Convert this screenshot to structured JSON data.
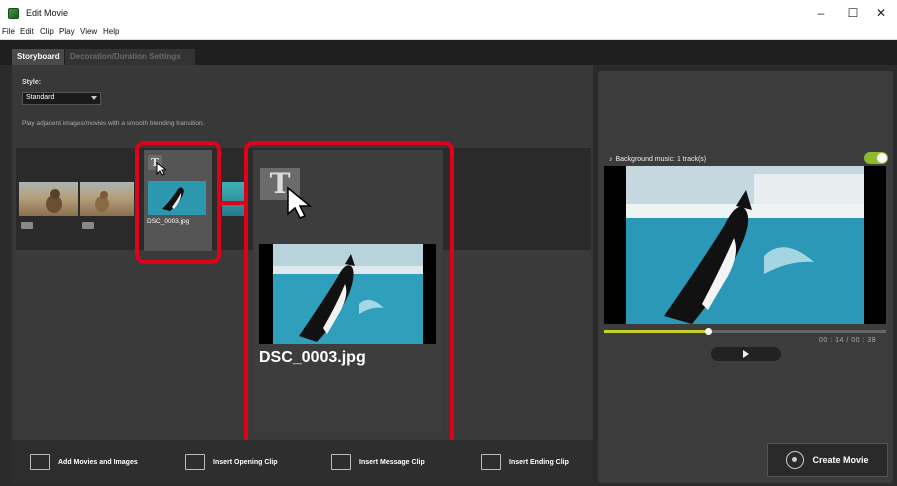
{
  "window": {
    "title": "Edit Movie",
    "minimize": "–",
    "maximize": "☐",
    "close": "✕"
  },
  "menu": [
    "File",
    "Edit",
    "Clip",
    "Play",
    "View",
    "Help"
  ],
  "tabs": [
    {
      "label": "Storyboard",
      "active": true
    },
    {
      "label": "Decoration/Duration Settings",
      "active": false
    }
  ],
  "style": {
    "label": "Style:",
    "value": "Standard",
    "description": "Play adjacent images/movies with a smooth blending transition."
  },
  "clips": {
    "selected_title_icon": "T",
    "selected_name": "DSC_0003.jpg",
    "zoom_name": "DSC_0003.jpg"
  },
  "bottom_buttons": [
    {
      "label": "Add Movies and Images",
      "icon": "add-media-icon"
    },
    {
      "label": "Insert Opening Clip",
      "icon": "opening-clip-icon"
    },
    {
      "label": "Insert Message Clip",
      "icon": "message-clip-icon"
    },
    {
      "label": "Insert Ending Clip",
      "icon": "ending-clip-icon"
    }
  ],
  "preview": {
    "bg_music": "Background music: 1 track(s)",
    "music_icon": "♪",
    "music_enabled": true,
    "time": "00 : 14  /  00 : 38",
    "progress": 0.37
  },
  "create_button": {
    "label": "Create Movie",
    "icon": "film-reel-icon"
  },
  "colors": {
    "highlight": "#e0001a",
    "accent": "#8dbb2a",
    "progress": "#c8d02a"
  }
}
